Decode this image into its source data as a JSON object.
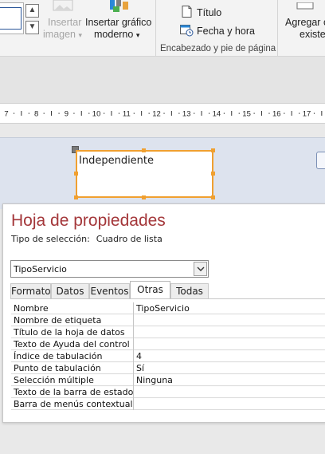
{
  "ribbon": {
    "insert_image_label_line1": "Insertar",
    "insert_image_label_line2": "imagen",
    "insert_chart_label_line1": "Insertar gráfico",
    "insert_chart_label_line2": "moderno",
    "title_label": "Título",
    "date_time_label": "Fecha y hora",
    "header_footer_group": "Encabezado y pie de página",
    "add_existing_line1": "Agregar c",
    "add_existing_line2": "existe",
    "chevron": "▾",
    "gallery_up": "▲",
    "gallery_down": "▼",
    "brand_color": "#2b579a"
  },
  "ruler": {
    "numbers": [
      "7",
      "8",
      "9",
      "10",
      "11",
      "12",
      "13",
      "14",
      "15",
      "16",
      "17"
    ]
  },
  "design": {
    "control_label": "Independiente",
    "selection_color": "#f0a030"
  },
  "property_sheet": {
    "title": "Hoja de propiedades",
    "selection_type_label": "Tipo de selección:",
    "selection_type_value": "Cuadro de lista",
    "object_selector_value": "TipoServicio",
    "title_color": "#a4373a",
    "tabs": [
      {
        "label": "Formato",
        "active": false
      },
      {
        "label": "Datos",
        "active": false
      },
      {
        "label": "Eventos",
        "active": false
      },
      {
        "label": "Otras",
        "active": true
      },
      {
        "label": "Todas",
        "active": false
      }
    ],
    "properties": [
      {
        "name": "Nombre",
        "value": "TipoServicio"
      },
      {
        "name": "Nombre de etiqueta",
        "value": ""
      },
      {
        "name": "Título de la hoja de datos",
        "value": ""
      },
      {
        "name": "Texto de Ayuda del control",
        "value": ""
      },
      {
        "name": "Índice de tabulación",
        "value": "4"
      },
      {
        "name": "Punto de tabulación",
        "value": "Sí"
      },
      {
        "name": "Selección múltiple",
        "value": "Ninguna"
      },
      {
        "name": "Texto de la barra de estado",
        "value": ""
      },
      {
        "name": "Barra de menús contextuales",
        "value": ""
      }
    ]
  }
}
